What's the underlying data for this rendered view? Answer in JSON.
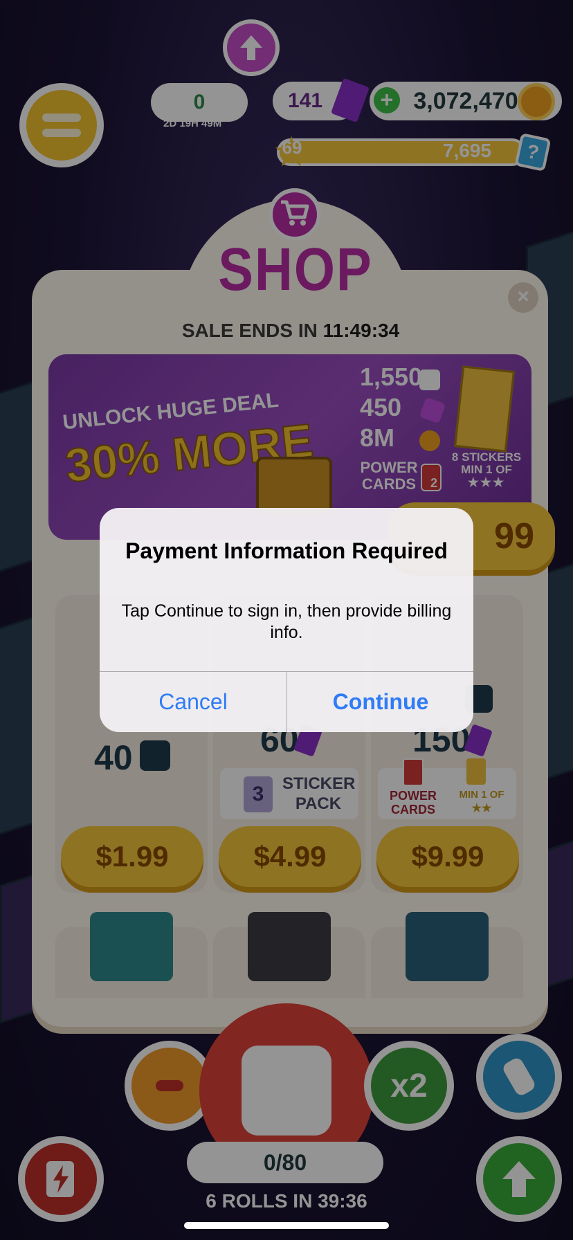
{
  "hud": {
    "carrots": "0",
    "carrot_timer": "2D 19H 49M",
    "gems": "141",
    "coins": "3,072,470",
    "coins_plus": "+",
    "level": "69",
    "xp": "7,695",
    "help": "?"
  },
  "shop": {
    "title": "SHOP",
    "sale_label": "SALE ENDS IN",
    "sale_time": "11:49:34",
    "close": "×",
    "deal": {
      "unlock_label": "UNLOCK HUGE DEAL",
      "more_label": "30% MORE",
      "dice": "1,550",
      "gems": "450",
      "coins": "8M",
      "power_cards_label": "POWER CARDS",
      "power_cards_count": "2",
      "stickers_label": "8 STICKERS",
      "stickers_min": "MIN 1 OF",
      "stickers_stars": "★★★",
      "price_visible": "99"
    },
    "offers": [
      {
        "amount": "40",
        "price": "$1.99"
      },
      {
        "amount": "60",
        "sticker_count": "3",
        "sticker_label": "STICKER PACK",
        "price": "$4.99"
      },
      {
        "amount": "150",
        "power_label": "POWER CARDS",
        "min_label": "MIN 1 OF",
        "stars": "★★",
        "price": "$9.99"
      }
    ]
  },
  "bottom": {
    "rolls": "0/80",
    "rolls_timer": "6 ROLLS IN 39:36",
    "x2": "x2"
  },
  "alert": {
    "title": "Payment Information Required",
    "message": "Tap Continue to sign in, then provide billing info.",
    "cancel": "Cancel",
    "continue": "Continue"
  },
  "colors": {
    "accent": "#2f7cf6",
    "shop_purple": "#b92ea6",
    "gold": "#f5c73d"
  }
}
